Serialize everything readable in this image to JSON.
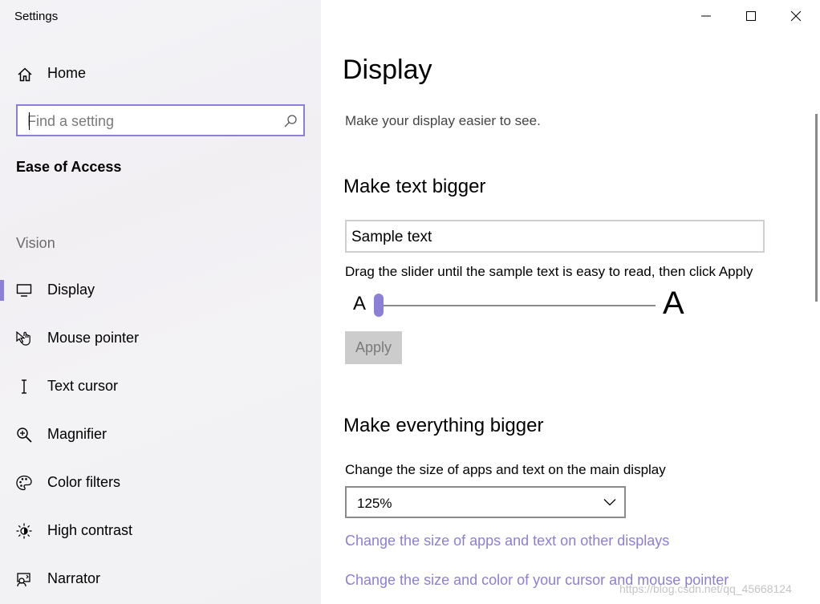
{
  "app_title": "Settings",
  "sidebar": {
    "home_label": "Home",
    "search_placeholder": "Find a setting",
    "section_title": "Ease of Access",
    "group_label": "Vision",
    "items": [
      {
        "label": "Display",
        "icon": "monitor-icon",
        "selected": true
      },
      {
        "label": "Mouse pointer",
        "icon": "mouse-pointer-icon",
        "selected": false
      },
      {
        "label": "Text cursor",
        "icon": "text-cursor-icon",
        "selected": false
      },
      {
        "label": "Magnifier",
        "icon": "magnifier-icon",
        "selected": false
      },
      {
        "label": "Color filters",
        "icon": "palette-icon",
        "selected": false
      },
      {
        "label": "High contrast",
        "icon": "sun-icon",
        "selected": false
      },
      {
        "label": "Narrator",
        "icon": "narrator-icon",
        "selected": false
      }
    ]
  },
  "main": {
    "title": "Display",
    "subtitle": "Make your display easier to see.",
    "text_section": {
      "heading": "Make text bigger",
      "sample_text": "Sample text",
      "instruction": "Drag the slider until the sample text is easy to read, then click Apply",
      "small_a": "A",
      "large_a": "A",
      "slider_value_fraction": 0,
      "apply_label": "Apply"
    },
    "everything_section": {
      "heading": "Make everything bigger",
      "size_label": "Change the size of apps and text on the main display",
      "size_value": "125%",
      "link_other_displays": "Change the size of apps and text on other displays",
      "link_cursor": "Change the size and color of your cursor and mouse pointer"
    }
  },
  "watermark": "https://blog.csdn.net/qq_45668124",
  "colors": {
    "accent": "#8c7fd6",
    "sidebar_bg": "#f2f1f4",
    "button_disabled_bg": "#cccccc"
  }
}
